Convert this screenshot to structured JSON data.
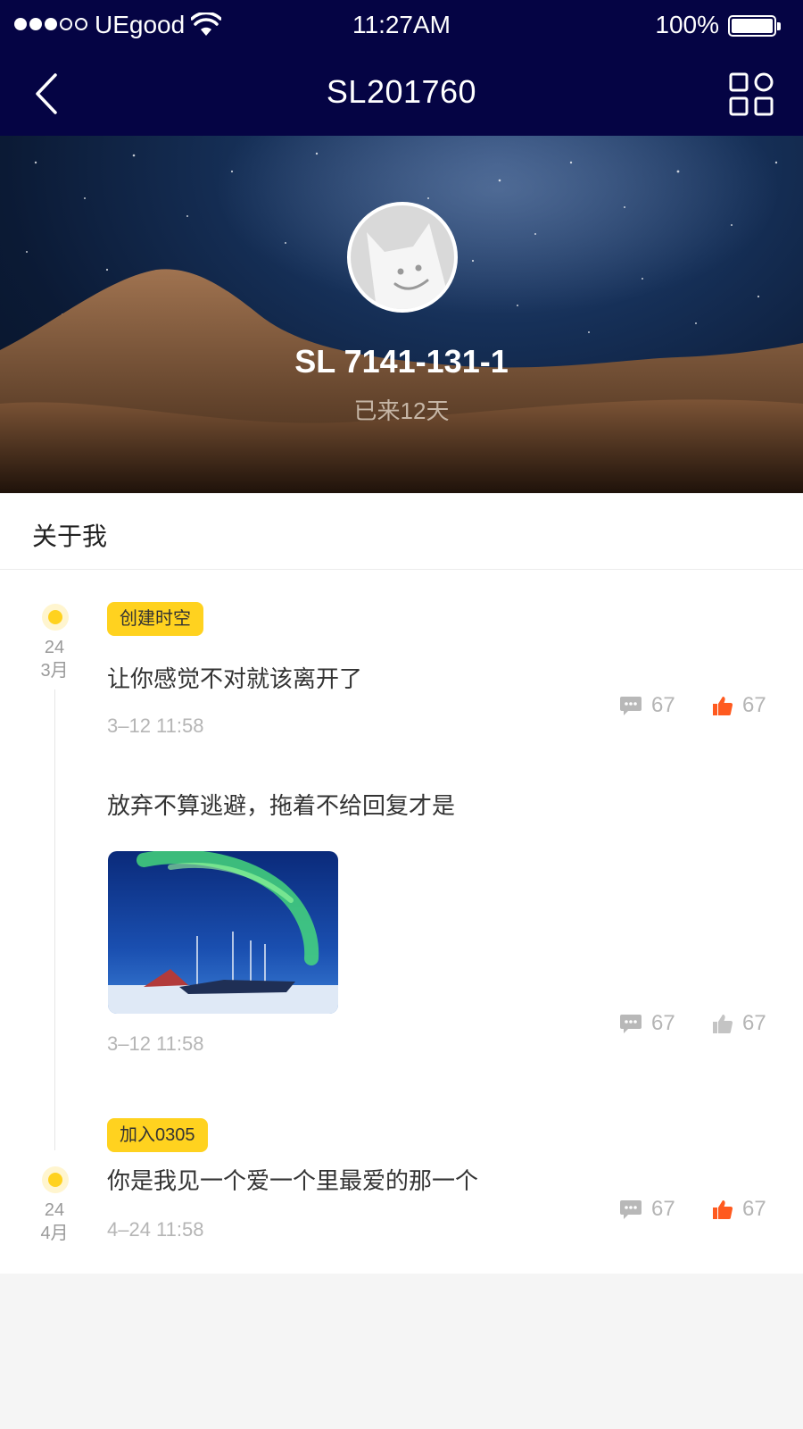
{
  "status_bar": {
    "carrier": "UEgood",
    "time": "11:27AM",
    "battery": "100%"
  },
  "nav": {
    "title": "SL201760"
  },
  "profile": {
    "name": "SL 7141-131-1",
    "days": "已来12天"
  },
  "about": {
    "label": "关于我"
  },
  "timeline": {
    "groups": [
      {
        "date_day": "24",
        "date_month": "3月",
        "tag": "创建时空",
        "posts": [
          {
            "text": "让你感觉不对就该离开了",
            "time": "3–12 11:58",
            "comments": "67",
            "likes": "67",
            "liked": true
          },
          {
            "text": "放弃不算逃避，拖着不给回复才是",
            "time": "3–12 11:58",
            "comments": "67",
            "likes": "67",
            "liked": false,
            "has_image": true
          }
        ]
      },
      {
        "date_day": "24",
        "date_month": "4月",
        "tag": "加入0305",
        "posts": [
          {
            "text": "你是我见一个爱一个里最爱的那一个",
            "time": "4–24 11:58",
            "comments": "67",
            "likes": "67",
            "liked": true
          }
        ]
      }
    ]
  },
  "colors": {
    "nav_bg": "#050444",
    "accent_yellow": "#ffd21f",
    "like_active": "#ff5a1f",
    "muted_gray": "#b5b5b5"
  }
}
